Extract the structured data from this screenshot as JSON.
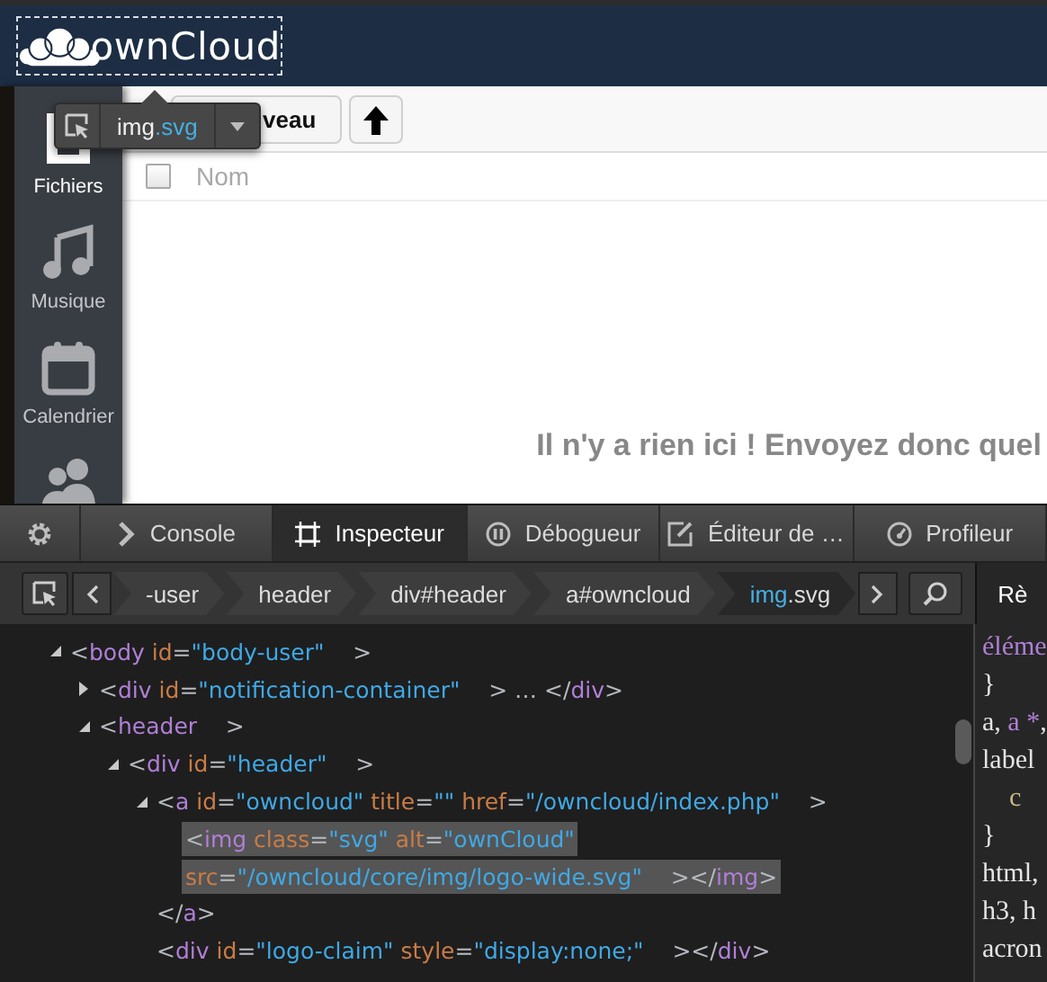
{
  "header": {
    "logo_text": "ownCloud",
    "highlighted": true
  },
  "sidebar": {
    "items": [
      {
        "kind": "files",
        "label": "Fichiers",
        "selected": true
      },
      {
        "kind": "music",
        "label": "Musique",
        "selected": false
      },
      {
        "kind": "calendar",
        "label": "Calendrier",
        "selected": false
      },
      {
        "kind": "contacts",
        "selected": false
      }
    ]
  },
  "toolbar": {
    "new_button": "veau"
  },
  "file_list": {
    "columns": [
      {
        "label": "Nom"
      }
    ],
    "select_all_checked": false,
    "empty_message": "Il n'y a rien ici ! Envoyez donc quel"
  },
  "node_tooltip": {
    "tag": "img",
    "suffix": ".svg"
  },
  "devtools": {
    "tabs": [
      {
        "kind": "options",
        "selected": false
      },
      {
        "kind": "console",
        "label": "Console",
        "selected": false
      },
      {
        "kind": "inspector",
        "label": "Inspecteur",
        "selected": true
      },
      {
        "kind": "debugger",
        "label": "Débogueur",
        "selected": false
      },
      {
        "kind": "editor",
        "label": "Éditeur de …",
        "selected": false
      },
      {
        "kind": "profiler",
        "label": "Profileur",
        "selected": false
      }
    ],
    "breadcrumbs": [
      {
        "tag": "-user",
        "selected": false
      },
      {
        "tag": "header",
        "selected": false
      },
      {
        "tag": "div",
        "suffix": "#header",
        "selected": false
      },
      {
        "tag": "a",
        "suffix": "#owncloud",
        "selected": false
      },
      {
        "tag": "img",
        "suffix": ".svg",
        "selected": true
      }
    ],
    "side_panel_tab": "Rè",
    "markup": [
      {
        "expanded": true,
        "selected": false,
        "lines": [
          [
            {
              "kind": "punct",
              "text": "<"
            },
            {
              "kind": "tag",
              "text": "body"
            },
            {
              "kind": "attr",
              "text": " id"
            },
            {
              "kind": "punct",
              "text": "="
            },
            {
              "kind": "value",
              "text": "\"body-user\""
            },
            {
              "kind": "punct",
              "text": "    >"
            }
          ]
        ],
        "children": [
          {
            "expanded": false,
            "selected": false,
            "lines": [
              [
                {
                  "kind": "punct",
                  "text": "<"
                },
                {
                  "kind": "tag",
                  "text": "div"
                },
                {
                  "kind": "attr",
                  "text": " id"
                },
                {
                  "kind": "punct",
                  "text": "="
                },
                {
                  "kind": "value",
                  "text": "\"notification-container\""
                },
                {
                  "kind": "punct",
                  "text": "    > … </"
                },
                {
                  "kind": "tag",
                  "text": "div"
                },
                {
                  "kind": "punct",
                  "text": ">"
                }
              ]
            ]
          },
          {
            "expanded": true,
            "selected": false,
            "lines": [
              [
                {
                  "kind": "punct",
                  "text": "<"
                },
                {
                  "kind": "tag",
                  "text": "header"
                },
                {
                  "kind": "punct",
                  "text": "    >"
                }
              ]
            ],
            "children": [
              {
                "expanded": true,
                "selected": false,
                "lines": [
                  [
                    {
                      "kind": "punct",
                      "text": "<"
                    },
                    {
                      "kind": "tag",
                      "text": "div"
                    },
                    {
                      "kind": "attr",
                      "text": " id"
                    },
                    {
                      "kind": "punct",
                      "text": "="
                    },
                    {
                      "kind": "value",
                      "text": "\"header\""
                    },
                    {
                      "kind": "punct",
                      "text": "    >"
                    }
                  ]
                ],
                "children": [
                  {
                    "expanded": true,
                    "selected": false,
                    "lines": [
                      [
                        {
                          "kind": "punct",
                          "text": "<"
                        },
                        {
                          "kind": "tag",
                          "text": "a"
                        },
                        {
                          "kind": "attr",
                          "text": " id"
                        },
                        {
                          "kind": "punct",
                          "text": "="
                        },
                        {
                          "kind": "value",
                          "text": "\"owncloud\""
                        },
                        {
                          "kind": "attr",
                          "text": " title"
                        },
                        {
                          "kind": "punct",
                          "text": "="
                        },
                        {
                          "kind": "value",
                          "text": "\"\""
                        },
                        {
                          "kind": "attr",
                          "text": " href"
                        },
                        {
                          "kind": "punct",
                          "text": "="
                        },
                        {
                          "kind": "value",
                          "text": "\"/owncloud/index.php\""
                        },
                        {
                          "kind": "punct",
                          "text": "    >"
                        }
                      ]
                    ],
                    "close": [
                      {
                        "kind": "punct",
                        "text": "</"
                      },
                      {
                        "kind": "tag",
                        "text": "a"
                      },
                      {
                        "kind": "punct",
                        "text": ">"
                      }
                    ],
                    "children": [
                      {
                        "selected": true,
                        "lines": [
                          [
                            {
                              "kind": "punct",
                              "text": "<"
                            },
                            {
                              "kind": "tag",
                              "text": "img"
                            },
                            {
                              "kind": "attr",
                              "text": " class"
                            },
                            {
                              "kind": "punct",
                              "text": "="
                            },
                            {
                              "kind": "value",
                              "text": "\"svg\""
                            },
                            {
                              "kind": "attr",
                              "text": " alt"
                            },
                            {
                              "kind": "punct",
                              "text": "="
                            },
                            {
                              "kind": "value",
                              "text": "\"ownCloud\""
                            }
                          ],
                          [
                            {
                              "kind": "attr",
                              "text": "src"
                            },
                            {
                              "kind": "punct",
                              "text": "="
                            },
                            {
                              "kind": "value",
                              "text": "\"/owncloud/core/img/logo-wide.svg\""
                            },
                            {
                              "kind": "punct",
                              "text": "    ></"
                            },
                            {
                              "kind": "tag",
                              "text": "img"
                            },
                            {
                              "kind": "punct",
                              "text": ">"
                            }
                          ]
                        ]
                      }
                    ]
                  },
                  {
                    "selected": false,
                    "lines": [
                      [
                        {
                          "kind": "punct",
                          "text": "<"
                        },
                        {
                          "kind": "tag",
                          "text": "div"
                        },
                        {
                          "kind": "attr",
                          "text": " id"
                        },
                        {
                          "kind": "punct",
                          "text": "="
                        },
                        {
                          "kind": "value",
                          "text": "\"logo-claim\""
                        },
                        {
                          "kind": "attr",
                          "text": " style"
                        },
                        {
                          "kind": "punct",
                          "text": "="
                        },
                        {
                          "kind": "value",
                          "text": "\"display:none;\""
                        },
                        {
                          "kind": "punct",
                          "text": "    ></"
                        },
                        {
                          "kind": "tag",
                          "text": "div"
                        },
                        {
                          "kind": "punct",
                          "text": ">"
                        }
                      ]
                    ]
                  }
                ]
              }
            ]
          }
        ]
      }
    ],
    "rules": [
      {
        "kind": "selector",
        "parts": [
          {
            "kind": "pseudo",
            "text": "éléme"
          }
        ]
      },
      {
        "kind": "selector",
        "parts": [
          {
            "kind": "plain",
            "text": "}"
          }
        ]
      },
      {
        "kind": "selector",
        "parts": [
          {
            "kind": "plain",
            "text": "a, "
          },
          {
            "kind": "pseudo",
            "text": "a *"
          },
          {
            "kind": "plain",
            "text": ","
          }
        ]
      },
      {
        "kind": "selector",
        "parts": [
          {
            "kind": "plain",
            "text": "label"
          }
        ]
      },
      {
        "kind": "declaration",
        "parts": [
          {
            "kind": "property",
            "text": "c"
          }
        ]
      },
      {
        "kind": "selector",
        "parts": [
          {
            "kind": "plain",
            "text": "}"
          }
        ]
      },
      {
        "kind": "selector",
        "parts": [
          {
            "kind": "plain",
            "text": "html,"
          }
        ]
      },
      {
        "kind": "selector",
        "parts": [
          {
            "kind": "plain",
            "text": "h3, h"
          }
        ]
      },
      {
        "kind": "selector",
        "parts": [
          {
            "kind": "plain",
            "text": "acron"
          }
        ]
      }
    ]
  }
}
